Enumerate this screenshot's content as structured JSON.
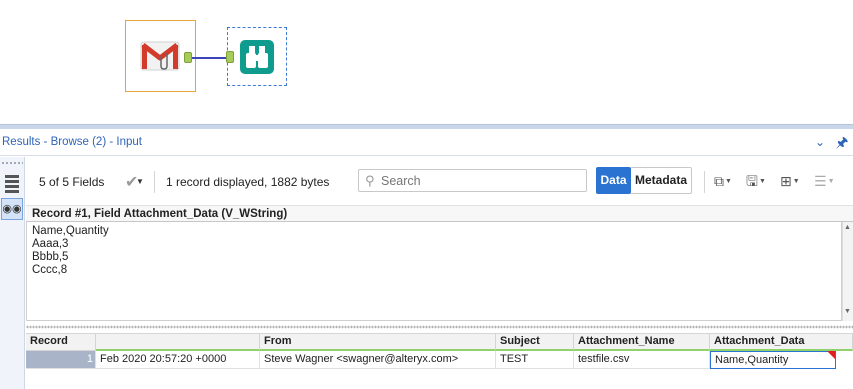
{
  "canvas": {
    "tools": [
      {
        "name": "gmail-input-tool",
        "icon": "gmail-icon"
      },
      {
        "name": "browse-tool",
        "icon": "binoculars-icon"
      }
    ]
  },
  "results": {
    "title": "Results - Browse (2) - Input"
  },
  "toolbar": {
    "fields_label": "5 of 5 Fields",
    "record_info": "1 record displayed, 1882 bytes",
    "search_placeholder": "Search",
    "data_label": "Data",
    "metadata_label": "Metadata"
  },
  "cell_viewer": {
    "title": "Record #1, Field Attachment_Data (V_WString)",
    "content": "Name,Quantity\nAaaa,3\nBbbb,5\nCccc,8"
  },
  "grid": {
    "columns": [
      "Record",
      "",
      "From",
      "Subject",
      "Attachment_Name",
      "Attachment_Data"
    ],
    "rows": [
      {
        "record": "1",
        "date": "Feb 2020 20:57:20 +0000",
        "from": "Steve Wagner <swagner@alteryx.com>",
        "subject": "TEST",
        "attachment_name": "testfile.csv",
        "attachment_data": "Name,Quantity"
      }
    ]
  },
  "colors": {
    "accent": "#2b73d1",
    "tool_selected_border": "#e8a13a",
    "connector": "#3a47b8",
    "browse_tool": "#0f9b8e"
  }
}
